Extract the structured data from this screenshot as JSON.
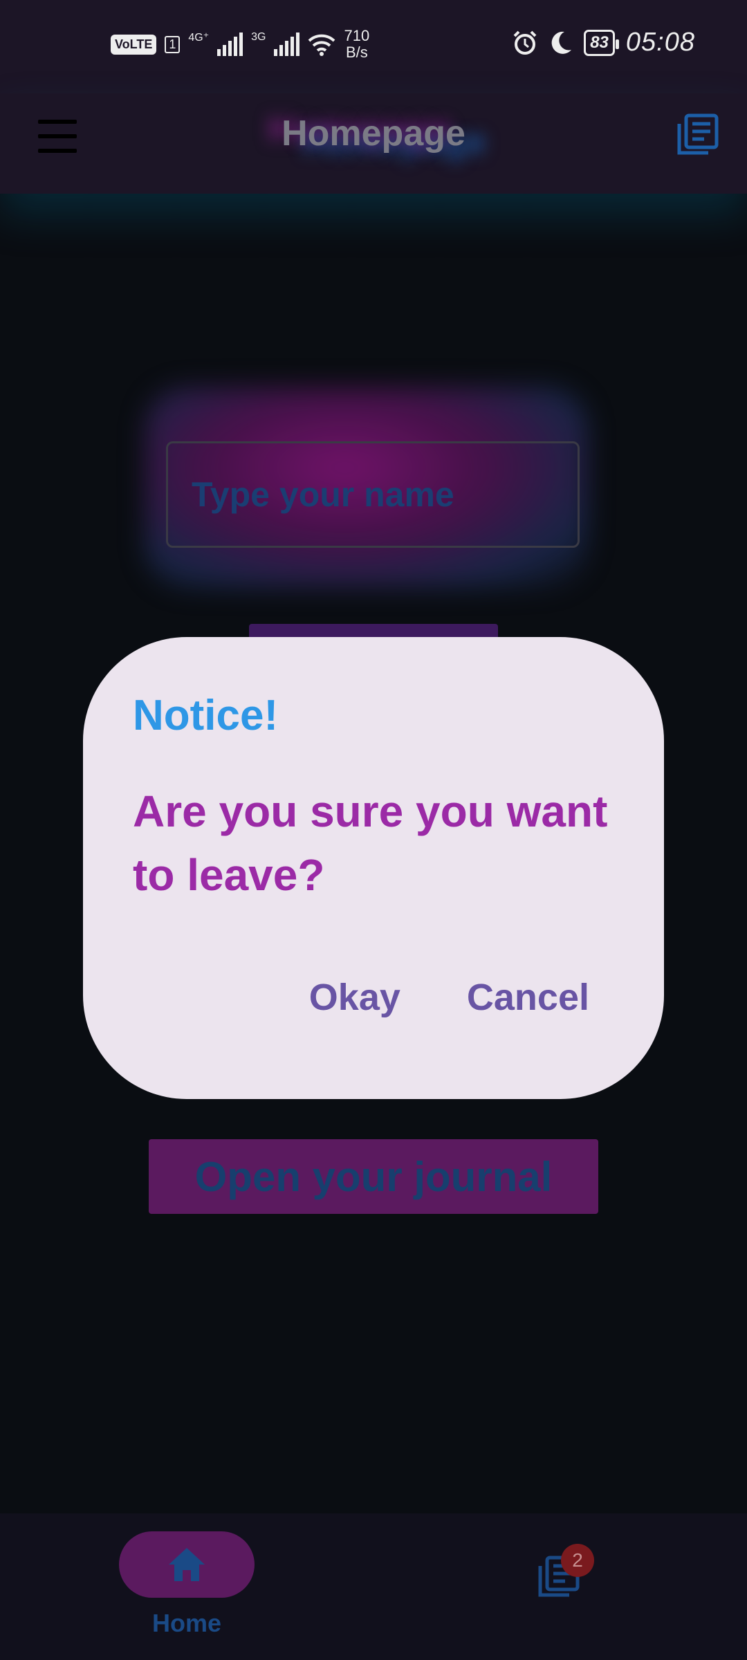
{
  "status_bar": {
    "volte": "VoLTE",
    "sim": "1",
    "net1": "4G⁺",
    "net2": "3G",
    "speed_value": "710",
    "speed_unit": "B/s",
    "battery": "83",
    "time": "05:08",
    "icons": [
      "signal-icon",
      "wifi-icon",
      "alarm-icon",
      "moon-icon",
      "battery-icon"
    ]
  },
  "app_bar": {
    "title": "Homepage",
    "menu_icon": "hamburger-icon",
    "journal_icon": "journal-icon"
  },
  "main": {
    "name_input": {
      "value": "",
      "placeholder": "Type your name"
    },
    "journal_button": "Open your journal"
  },
  "dialog": {
    "title": "Notice!",
    "message": "Are you sure you want to leave?",
    "ok_label": "Okay",
    "cancel_label": "Cancel"
  },
  "bottom_nav": {
    "home_label": "Home",
    "home_icon": "home-icon",
    "journal_icon": "journal-icon",
    "journal_badge": "2"
  },
  "colors": {
    "background": "#0a0d12",
    "bar": "#1c1526",
    "dialog_bg": "#ece4ee",
    "title_blue": "#2e97e6",
    "message_purple": "#9b2aa6",
    "action_purple": "#6854a4",
    "accent_magenta": "#5b1a5f"
  }
}
